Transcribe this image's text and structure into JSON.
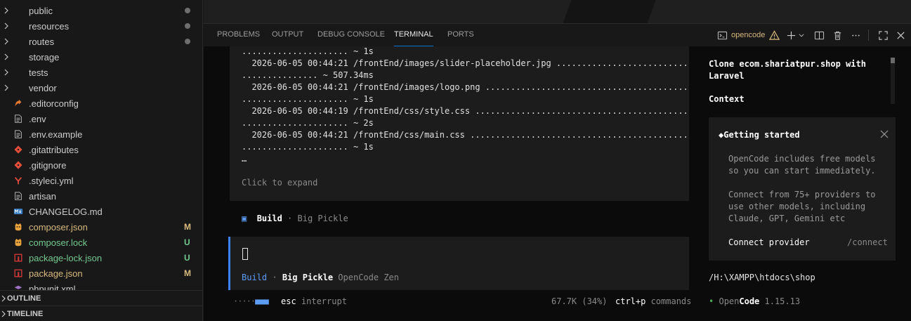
{
  "explorer": {
    "items": [
      {
        "name": "public",
        "type": "folder",
        "status": "dot"
      },
      {
        "name": "resources",
        "type": "folder",
        "status": "dot"
      },
      {
        "name": "routes",
        "type": "folder",
        "status": "dot"
      },
      {
        "name": "storage",
        "type": "folder",
        "status": ""
      },
      {
        "name": "tests",
        "type": "folder",
        "status": ""
      },
      {
        "name": "vendor",
        "type": "folder",
        "status": ""
      },
      {
        "name": ".editorconfig",
        "type": "editorconfig",
        "status": ""
      },
      {
        "name": ".env",
        "type": "text",
        "status": ""
      },
      {
        "name": ".env.example",
        "type": "text",
        "status": ""
      },
      {
        "name": ".gitattributes",
        "type": "git",
        "status": ""
      },
      {
        "name": ".gitignore",
        "type": "git",
        "status": ""
      },
      {
        "name": ".styleci.yml",
        "type": "yml",
        "status": ""
      },
      {
        "name": "artisan",
        "type": "text",
        "status": ""
      },
      {
        "name": "CHANGELOG.md",
        "type": "markdown",
        "status": ""
      },
      {
        "name": "composer.json",
        "type": "composer",
        "status": "M"
      },
      {
        "name": "composer.lock",
        "type": "composer",
        "status": "U"
      },
      {
        "name": "package-lock.json",
        "type": "npm",
        "status": "U"
      },
      {
        "name": "package.json",
        "type": "npm",
        "status": "M"
      },
      {
        "name": "phpunit.xml",
        "type": "xml",
        "status": ""
      }
    ],
    "outline_label": "OUTLINE",
    "timeline_label": "TIMELINE"
  },
  "panel": {
    "tabs": [
      "PROBLEMS",
      "OUTPUT",
      "DEBUG CONSOLE",
      "TERMINAL",
      "PORTS"
    ],
    "active_tab": "TERMINAL",
    "terminal_name": "opencode"
  },
  "terminal": {
    "log_lines": [
      "..................... ~ 1s",
      "  2026-06-05 00:44:21 /frontEnd/images/slider-placeholder.jpg ..............................",
      "............... ~ 507.34ms",
      "  2026-06-05 00:44:21 /frontEnd/images/logo.png ............................................",
      "..................... ~ 1s",
      "  2026-06-05 00:44:19 /frontEnd/css/style.css ..............................................",
      "..................... ~ 2s",
      "  2026-06-05 00:44:21 /frontEnd/css/main.css ...............................................",
      "..................... ~ 1s"
    ],
    "ellipsis": "…",
    "expand_hint": "Click to expand",
    "build_status": {
      "icon": "▣",
      "agent": "Build",
      "sep": " · ",
      "model": "Big Pickle"
    },
    "input_meta": {
      "agent": "Build",
      "sep": " · ",
      "model": "Big Pickle",
      "provider": "OpenCode Zen"
    },
    "bottom": {
      "spinner_off": "·····",
      "spinner_on": "■■■",
      "esc_key": "esc",
      "esc_label": " interrupt",
      "tokens": "67.7K (34%)",
      "cmd_key": "ctrl+p",
      "cmd_label": " commands"
    },
    "side": {
      "session_title": "Clone ecom.shariatpur.shop with Laravel",
      "context_label": "Context",
      "getting_started": {
        "title": "Getting started",
        "icon": "◆",
        "text1": "OpenCode includes free models so you can start immediately.",
        "text2": "Connect from 75+ providers to use other models, including Claude, GPT, Gemini etc",
        "connect_label": "Connect provider",
        "connect_cmd": "/connect"
      },
      "cwd": "/H:\\XAMPP\\htdocs\\shop",
      "version": {
        "dot": "•",
        "open": "Open",
        "code": "Code",
        "number": " 1.15.13"
      }
    }
  },
  "colors": {
    "accent": "#0078d4",
    "agent_blue": "#5c9cf5",
    "modified": "#d7ba7d",
    "untracked": "#73c991"
  }
}
